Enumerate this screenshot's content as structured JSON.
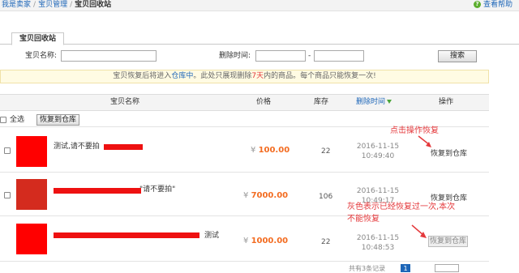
{
  "breadcrumb": {
    "seller": "我是卖家",
    "item_manage": "宝贝管理",
    "current": "宝贝回收站"
  },
  "help": {
    "label": "查看帮助"
  },
  "tab": {
    "label": "宝贝回收站"
  },
  "filters": {
    "name_label": "宝贝名称:",
    "name_value": "",
    "delete_time_label": "删除时间:",
    "date_from": "",
    "dash": "-",
    "date_to": "",
    "search_button": "搜索"
  },
  "notice": {
    "part1": "宝贝恢复后将进入",
    "warehouse_link": "仓库中",
    "part2": "。此处只展现删除",
    "days": "7天",
    "part3": "内的商品。每个商品只能恢复一次!"
  },
  "table": {
    "col_name": "宝贝名称",
    "col_price": "价格",
    "col_stock": "库存",
    "col_delete_time": "删除时间",
    "col_ops": "操作",
    "select_all_label": "全选",
    "bulk_restore_button": "恢复到仓库"
  },
  "rows": [
    {
      "title": "测试,请不要拍",
      "currency": "¥",
      "price": "100.00",
      "stock": "22",
      "date": "2016-11-15",
      "time": "10:49:40",
      "action": "恢复到仓库",
      "action_disabled": false
    },
    {
      "title": "\"请不要拍\"",
      "currency": "¥",
      "price": "7000.00",
      "stock": "106",
      "date": "2016-11-15",
      "time": "10:49:17",
      "action": "恢复到仓库",
      "action_disabled": false
    },
    {
      "title": "测试",
      "currency": "¥",
      "price": "1000.00",
      "stock": "22",
      "date": "2016-11-15",
      "time": "10:48:53",
      "action": "恢复到仓库",
      "action_disabled": true
    }
  ],
  "annotations": {
    "click_restore": "点击操作恢复",
    "gray_line1": "灰色表示已经恢复过一次,本次",
    "gray_line2": "不能恢复"
  },
  "pager": {
    "total": "共有3条记录",
    "current_page": "1"
  },
  "colors": {
    "accent_blue": "#1d66b8",
    "price_orange": "#f36c21",
    "annotation_red": "#e4393c",
    "notice_bg": "#fffbe3"
  },
  "icons": {
    "help": "help-icon",
    "sort": "sort-down-icon"
  }
}
